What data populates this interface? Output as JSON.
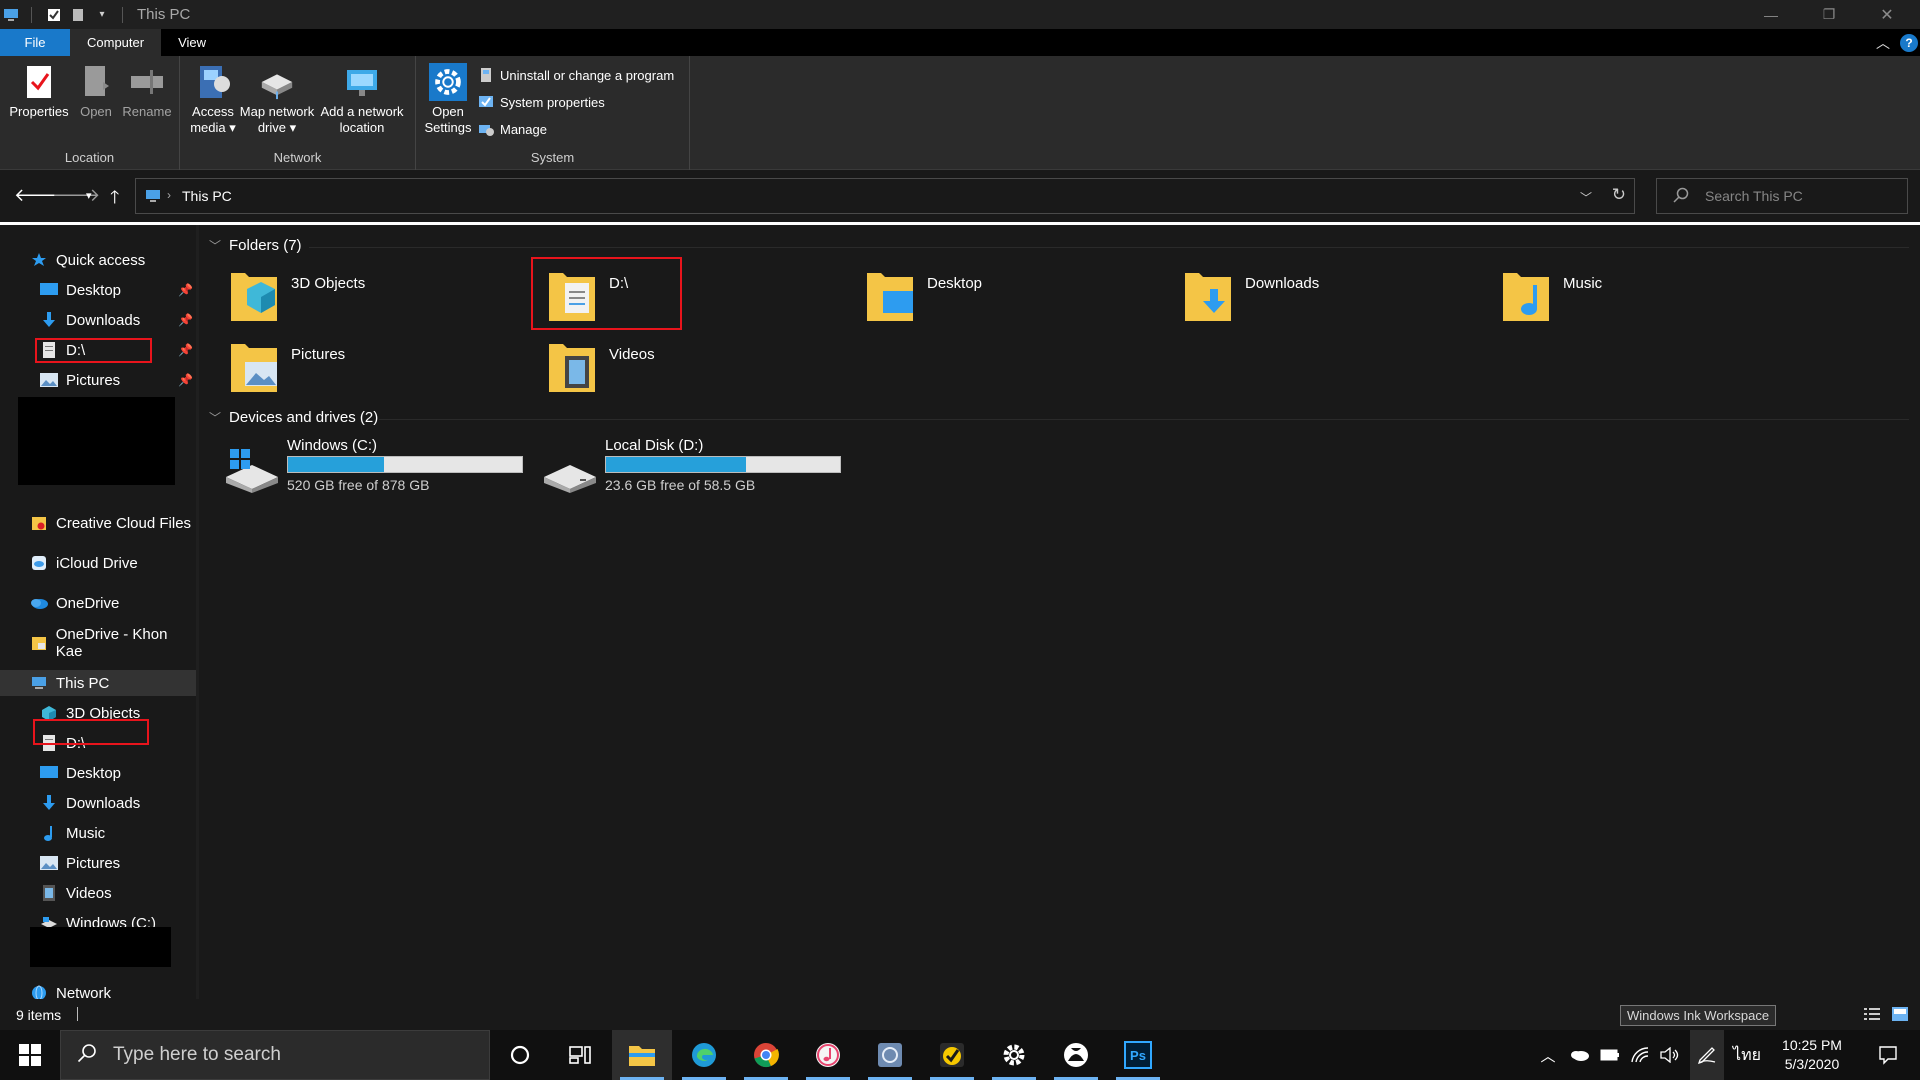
{
  "window": {
    "title": "This PC",
    "controls": {
      "minimize": "—",
      "maximize": "❐",
      "close": "✕"
    }
  },
  "ribbon": {
    "tabs": [
      "File",
      "Computer",
      "View"
    ],
    "active_tab": "Computer",
    "help": "?",
    "groups": {
      "location": {
        "label": "Location",
        "buttons": [
          "Properties",
          "Open",
          "Rename"
        ]
      },
      "network": {
        "label": "Network",
        "buttons": [
          {
            "line1": "Access",
            "line2": "media ▾"
          },
          {
            "line1": "Map network",
            "line2": "drive ▾"
          },
          {
            "line1": "Add a network",
            "line2": "location"
          }
        ]
      },
      "system": {
        "label": "System",
        "open_settings": {
          "line1": "Open",
          "line2": "Settings"
        },
        "small": [
          "Uninstall or change a program",
          "System properties",
          "Manage"
        ]
      }
    }
  },
  "address": {
    "path": "This PC",
    "search_placeholder": "Search This PC"
  },
  "nav": {
    "quick_access": "Quick access",
    "quick_items": [
      "Desktop",
      "Downloads",
      "D:\\",
      "Pictures"
    ],
    "cloud_items": [
      "Creative Cloud Files",
      "iCloud Drive",
      "OneDrive",
      "OneDrive - Khon Kae"
    ],
    "this_pc": "This PC",
    "pc_items": [
      "3D Objects",
      "D:\\",
      "Desktop",
      "Downloads",
      "Music",
      "Pictures",
      "Videos",
      "Windows (C:)"
    ],
    "network": "Network"
  },
  "content": {
    "folders_header": "Folders (7)",
    "folders": [
      "3D Objects",
      "D:\\",
      "Desktop",
      "Downloads",
      "Music",
      "Pictures",
      "Videos"
    ],
    "drives_header": "Devices and drives (2)",
    "drives": [
      {
        "name": "Windows (C:)",
        "free": "520 GB free of 878 GB",
        "used_fraction": 0.41
      },
      {
        "name": "Local Disk (D:)",
        "free": "23.6 GB free of 58.5 GB",
        "used_fraction": 0.6
      }
    ]
  },
  "status": {
    "items": "9 items",
    "tooltip": "Windows Ink Workspace"
  },
  "taskbar": {
    "search_placeholder": "Type here to search",
    "apps": [
      "cortana-icon",
      "task-view-icon",
      "file-explorer-icon",
      "edge-icon",
      "chrome-icon",
      "itunes-icon",
      "app-icon",
      "norton-icon",
      "settings-icon",
      "xbox-icon",
      "photoshop-icon"
    ],
    "photoshop_label": "Ps",
    "language": "ไทย",
    "time": "10:25 PM",
    "date": "5/3/2020"
  },
  "colors": {
    "accent": "#1979ca",
    "drive_bar": "#26a0da",
    "highlight_box": "#e8141c",
    "folder_yellow": "#f4c546"
  }
}
